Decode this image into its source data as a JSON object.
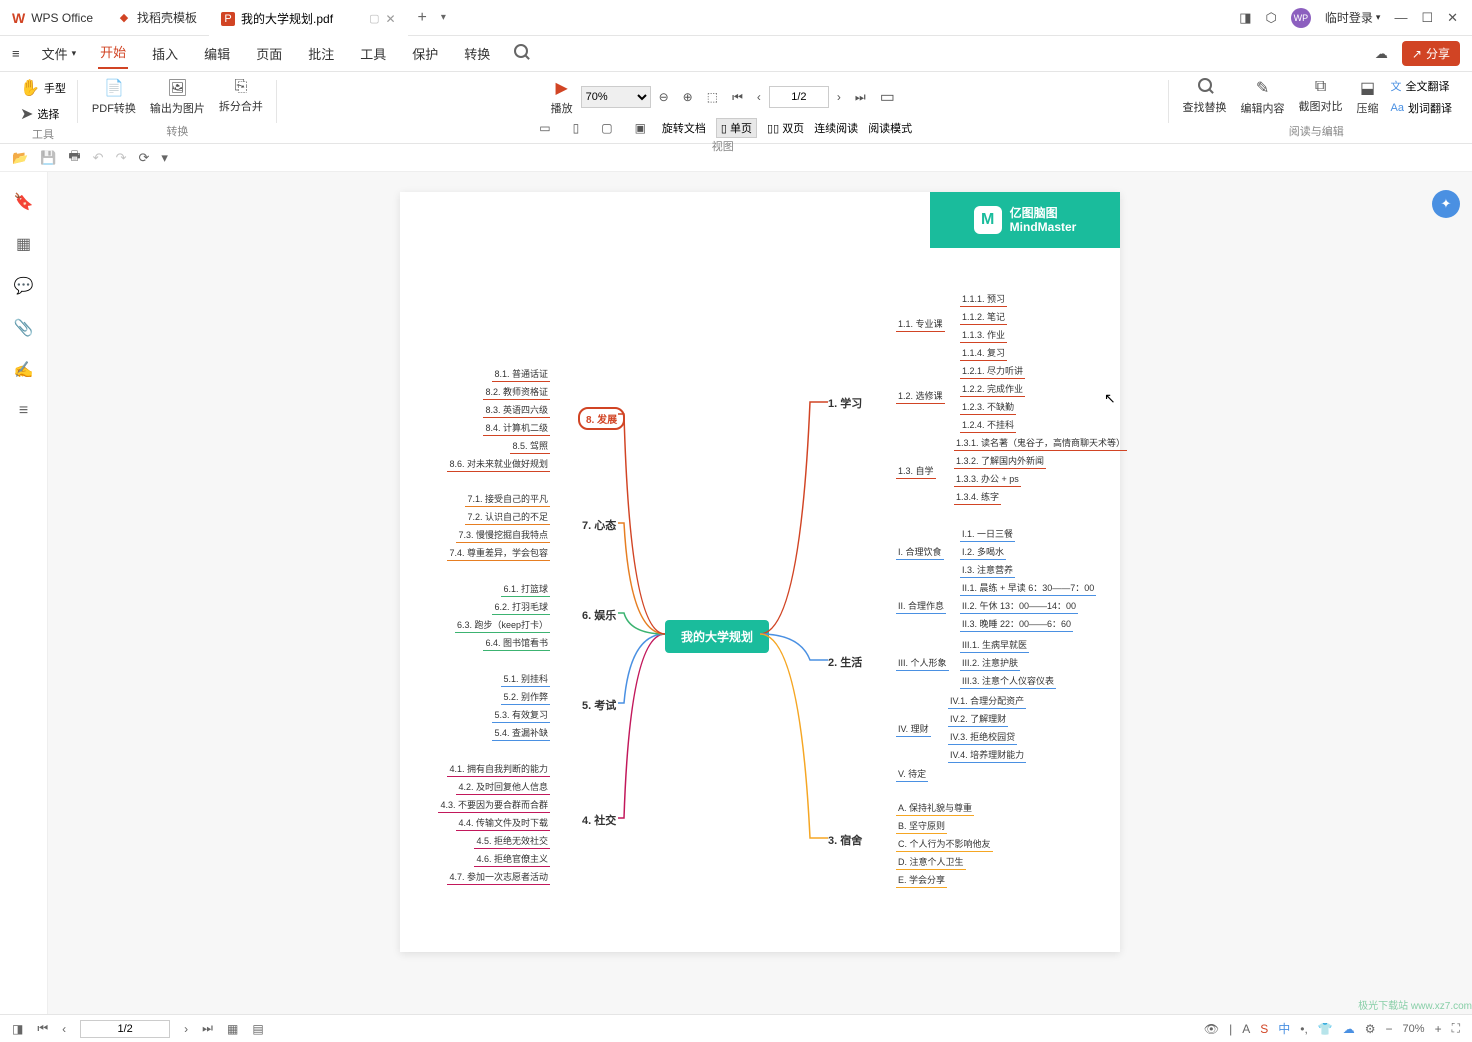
{
  "titlebar": {
    "wps_label": "WPS Office",
    "template_tab": "找稻壳模板",
    "file_tab": "我的大学规划.pdf",
    "user_login": "临时登录"
  },
  "menubar": {
    "file": "文件",
    "items": [
      "开始",
      "插入",
      "编辑",
      "页面",
      "批注",
      "工具",
      "保护",
      "转换"
    ],
    "share": "分享"
  },
  "ribbon": {
    "group_tool": "工具",
    "hand": "手型",
    "select": "选择",
    "group_convert": "转换",
    "pdf_convert": "PDF转换",
    "export_img": "输出为图片",
    "split_merge": "拆分合并",
    "play": "播放",
    "zoom_value": "70%",
    "page_value": "1/2",
    "group_view": "视图",
    "rotate": "旋转文档",
    "single_page": "单页",
    "dual_page": "双页",
    "continuous": "连续阅读",
    "read_mode": "阅读模式",
    "group_edit": "阅读与编辑",
    "find_replace": "查找替换",
    "edit_content": "编辑内容",
    "compare": "截图对比",
    "compress": "压缩",
    "translate_full": "全文翻译",
    "translate_sel": "划词翻译"
  },
  "mindmap": {
    "brand_cn": "亿图脑图",
    "brand_en": "MindMaster",
    "center": "我的大学规划",
    "branch_1": "1. 学习",
    "branch_2": "2. 生活",
    "branch_3": "3. 宿舍",
    "branch_4": "4. 社交",
    "branch_5": "5. 考试",
    "branch_6": "6. 娱乐",
    "branch_7": "7. 心态",
    "branch_8": "8. 发展",
    "n_1_1": "1.1. 专业课",
    "n_1_2": "1.2. 选修课",
    "n_1_3": "1.3. 自学",
    "n_1_1_1": "1.1.1. 预习",
    "n_1_1_2": "1.1.2. 笔记",
    "n_1_1_3": "1.1.3. 作业",
    "n_1_1_4": "1.1.4. 复习",
    "n_1_2_1": "1.2.1. 尽力听讲",
    "n_1_2_2": "1.2.2. 完成作业",
    "n_1_2_3": "1.2.3. 不缺勤",
    "n_1_2_4": "1.2.4. 不挂科",
    "n_1_3_1": "1.3.1. 读名著（鬼谷子，高情商聊天术等）",
    "n_1_3_2": "1.3.2. 了解国内外新闻",
    "n_1_3_3": "1.3.3. 办公 + ps",
    "n_1_3_4": "1.3.4. 练字",
    "n_2_1": "I. 合理饮食",
    "n_2_2": "II. 合理作息",
    "n_2_3": "III. 个人形象",
    "n_2_4": "IV. 理财",
    "n_2_5": "V. 待定",
    "n_2_1_1": "I.1. 一日三餐",
    "n_2_1_2": "I.2. 多喝水",
    "n_2_1_3": "I.3. 注意营养",
    "n_2_2_1": "II.1. 晨练 + 早读 6：30——7：00",
    "n_2_2_2": "II.2. 午休 13：00——14：00",
    "n_2_2_3": "II.3. 晚睡 22：00——6：60",
    "n_2_3_1": "III.1. 生病早就医",
    "n_2_3_2": "III.2. 注意护肤",
    "n_2_3_3": "III.3. 注意个人仪容仪表",
    "n_2_4_1": "IV.1. 合理分配资产",
    "n_2_4_2": "IV.2. 了解理财",
    "n_2_4_3": "IV.3. 拒绝校园贷",
    "n_2_4_4": "IV.4. 培养理财能力",
    "n_3_a": "A. 保持礼貌与尊重",
    "n_3_b": "B. 坚守原则",
    "n_3_c": "C. 个人行为不影响他友",
    "n_3_d": "D. 注意个人卫生",
    "n_3_e": "E. 学会分享",
    "n_4_1": "4.1. 拥有自我判断的能力",
    "n_4_2": "4.2. 及时回复他人信息",
    "n_4_3": "4.3. 不要因为要合群而合群",
    "n_4_4": "4.4. 传输文件及时下载",
    "n_4_5": "4.5. 拒绝无效社交",
    "n_4_6": "4.6. 拒绝官僚主义",
    "n_4_7": "4.7. 参加一次志愿者活动",
    "n_5_1": "5.1. 别挂科",
    "n_5_2": "5.2. 别作弊",
    "n_5_3": "5.3. 有效复习",
    "n_5_4": "5.4. 查漏补缺",
    "n_6_1": "6.1. 打篮球",
    "n_6_2": "6.2. 打羽毛球",
    "n_6_3": "6.3. 跑步（keep打卡）",
    "n_6_4": "6.4. 图书馆看书",
    "n_7_1": "7.1. 接受自己的平凡",
    "n_7_2": "7.2. 认识自己的不足",
    "n_7_3": "7.3. 慢慢挖掘自我特点",
    "n_7_4": "7.4. 尊重差异，学会包容",
    "n_8_1": "8.1. 普通话证",
    "n_8_2": "8.2. 教师资格证",
    "n_8_3": "8.3. 英语四六级",
    "n_8_4": "8.4. 计算机二级",
    "n_8_5": "8.5. 驾照",
    "n_8_6": "8.6. 对未来就业做好规划"
  },
  "statusbar": {
    "page": "1/2",
    "zoom": "70%"
  }
}
